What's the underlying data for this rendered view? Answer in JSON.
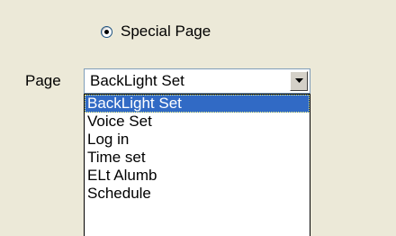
{
  "radio": {
    "label": "Special Page",
    "checked": true
  },
  "page": {
    "label": "Page",
    "selected_value": "BackLight Set",
    "icon": "chevron-down-icon"
  },
  "dropdown": {
    "options": [
      "BackLight Set",
      "Voice Set",
      "Log in",
      "Time set",
      "ELt Alumb",
      "Schedule"
    ],
    "highlighted_index": 0
  },
  "colors": {
    "background": "#ECE9D8",
    "highlight": "#316AC5",
    "border": "#7F9DB9"
  }
}
